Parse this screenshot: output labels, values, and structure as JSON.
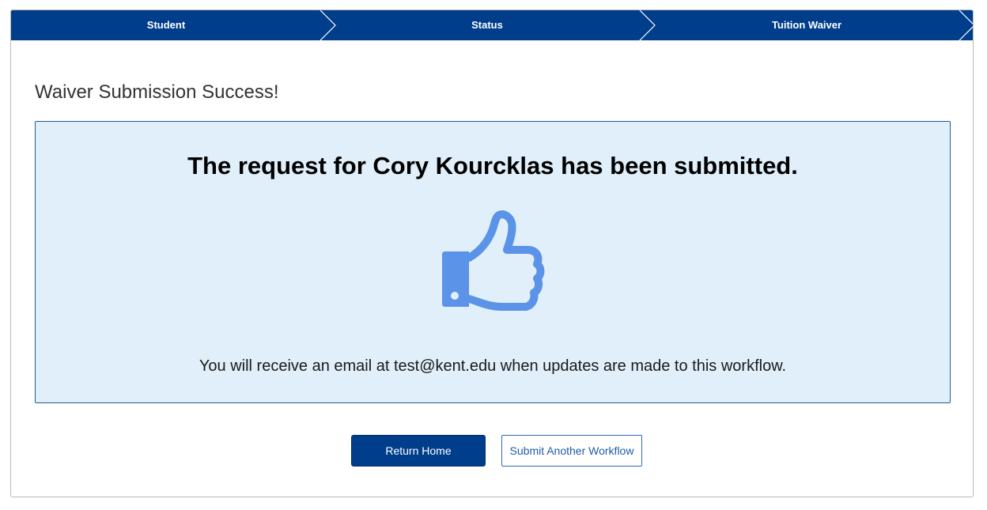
{
  "steps": [
    {
      "label": "Student"
    },
    {
      "label": "Status"
    },
    {
      "label": "Tuition Waiver"
    }
  ],
  "page_title": "Waiver Submission Success!",
  "success": {
    "headline": "The request for Cory Kourcklas has been submitted.",
    "icon": "thumbs-up-icon",
    "notice": "You will receive an email at test@kent.edu when updates are made to this workflow."
  },
  "actions": {
    "return_home": "Return Home",
    "submit_another": "Submit Another Workflow"
  },
  "colors": {
    "brand_blue": "#003e8c",
    "success_bg": "#e0eff9",
    "icon_blue": "#5b93e8"
  }
}
